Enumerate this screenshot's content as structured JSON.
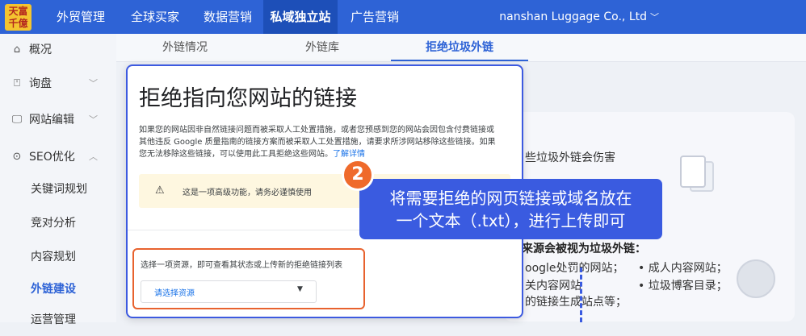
{
  "logo": {
    "line1": "天富",
    "line2": "千億"
  },
  "nav": [
    {
      "label": "外贸管理"
    },
    {
      "label": "全球买家"
    },
    {
      "label": "数据营销"
    },
    {
      "label": "私域独立站"
    },
    {
      "label": "广告营销"
    }
  ],
  "company": {
    "name": "nanshan Luggage Co., Ltd",
    "chevron": "﹀"
  },
  "sidebar": {
    "items": [
      {
        "icon": "⌂",
        "label": "概况",
        "arrow": ""
      },
      {
        "icon": "⍞",
        "label": "询盘",
        "arrow": "﹀"
      },
      {
        "icon": "🖵",
        "label": "网站编辑",
        "arrow": "﹀"
      },
      {
        "icon": "⊙",
        "label": "SEO优化",
        "arrow": "︿"
      }
    ],
    "subitems": [
      {
        "label": "关键词规划"
      },
      {
        "label": "竞对分析"
      },
      {
        "label": "内容规划"
      },
      {
        "label": "外链建设"
      },
      {
        "label": "运营管理"
      }
    ]
  },
  "tabs": [
    {
      "label": "外链情况"
    },
    {
      "label": "外链库"
    },
    {
      "label": "拒绝垃圾外链"
    }
  ],
  "background": {
    "line1": "些垃圾外链会伤害",
    "heading": "来源会被视为垃圾外链：",
    "bullet_a": "oogle处罚的网站；",
    "bullet_b": "• 成人内容网站；",
    "bullet_c": "关内容网站",
    "bullet_d": "• 垃圾博客目录；",
    "bullet_e": "的链接生成站点等；"
  },
  "dialog": {
    "title": "拒绝指向您网站的链接",
    "desc": "如果您的网站因非自然链接问题而被采取人工处置措施，或者您预感到您的网站会因包含付费链接或其他违反 Google 质量指南的链接方案而被采取人工处置措施，请要求所涉网站移除这些链接。如果您无法移除这些链接，可以使用此工具拒绝这些网站。",
    "link": "了解详情",
    "warning_icon": "⚠",
    "warning": "这是一项高级功能，请务必谨慎使用",
    "select_label": "选择一项资源，即可查看其状态或上传新的拒绝链接列表",
    "select_placeholder": "请选择资源",
    "select_caret": "▼"
  },
  "callout": {
    "step": "2",
    "line1": "将需要拒绝的网页链接或域名放在",
    "line2": "一个文本（.txt），进行上传即可"
  },
  "colors": {
    "primary": "#2e63d6",
    "callout": "#3a5be0",
    "accent": "#ef6a2b"
  }
}
